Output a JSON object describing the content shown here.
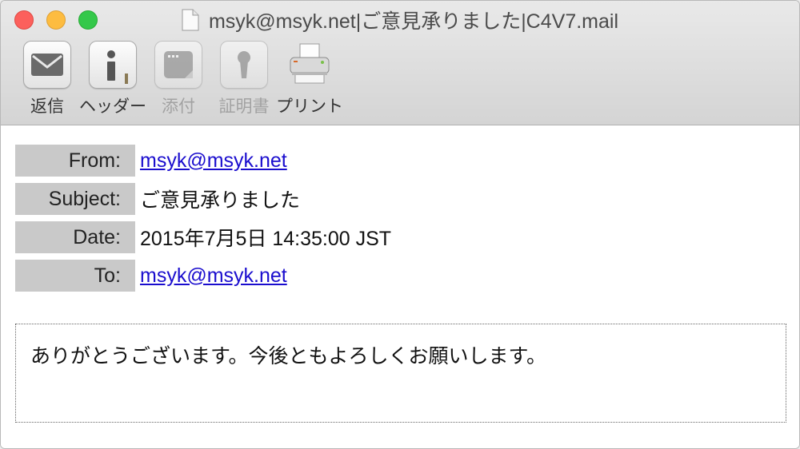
{
  "window": {
    "title": "msyk@msyk.net|ご意見承りました|C4V7.mail"
  },
  "toolbar": {
    "items": [
      {
        "label": "返信",
        "icon": "envelope-icon",
        "enabled": true
      },
      {
        "label": "ヘッダー",
        "icon": "info-icon",
        "enabled": true
      },
      {
        "label": "添付",
        "icon": "attachment-icon",
        "enabled": false
      },
      {
        "label": "証明書",
        "icon": "certificate-icon",
        "enabled": false
      },
      {
        "label": "プリント",
        "icon": "printer-icon",
        "enabled": true
      }
    ]
  },
  "headers": {
    "from_label": "From:",
    "from_value": "msyk@msyk.net",
    "subject_label": "Subject:",
    "subject_value": "ご意見承りました",
    "date_label": "Date:",
    "date_value": "2015年7月5日 14:35:00 JST",
    "to_label": "To:",
    "to_value": "msyk@msyk.net"
  },
  "message": {
    "body": "ありがとうございます。今後ともよろしくお願いします。"
  },
  "colors": {
    "link": "#1a0dce",
    "header_label_bg": "#c9c9c9",
    "close": "#fc605c",
    "minimize": "#fdbc40",
    "maximize": "#34c84a"
  }
}
